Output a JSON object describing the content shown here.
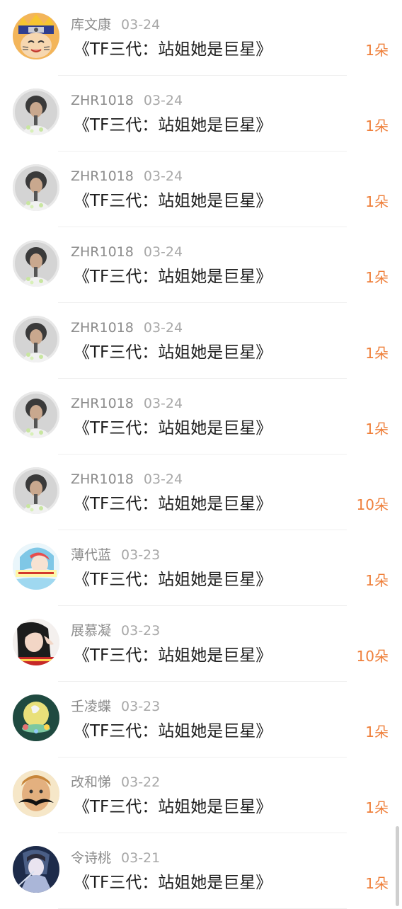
{
  "gift_list": [
    {
      "avatar": "avatar-naruto",
      "username": "库文康",
      "date": "03-24",
      "title": "《TF三代：站姐她是巨星》",
      "amount": "1朵"
    },
    {
      "avatar": "avatar-portrait-dark",
      "username": "ZHR1018",
      "date": "03-24",
      "title": "《TF三代：站姐她是巨星》",
      "amount": "1朵"
    },
    {
      "avatar": "avatar-portrait-dark",
      "username": "ZHR1018",
      "date": "03-24",
      "title": "《TF三代：站姐她是巨星》",
      "amount": "1朵"
    },
    {
      "avatar": "avatar-portrait-dark",
      "username": "ZHR1018",
      "date": "03-24",
      "title": "《TF三代：站姐她是巨星》",
      "amount": "1朵"
    },
    {
      "avatar": "avatar-portrait-dark",
      "username": "ZHR1018",
      "date": "03-24",
      "title": "《TF三代：站姐她是巨星》",
      "amount": "1朵"
    },
    {
      "avatar": "avatar-portrait-dark",
      "username": "ZHR1018",
      "date": "03-24",
      "title": "《TF三代：站姐她是巨星》",
      "amount": "1朵"
    },
    {
      "avatar": "avatar-portrait-dark",
      "username": "ZHR1018",
      "date": "03-24",
      "title": "《TF三代：站姐她是巨星》",
      "amount": "10朵"
    },
    {
      "avatar": "avatar-blue-anime",
      "username": "薄代蓝",
      "date": "03-23",
      "title": "《TF三代：站姐她是巨星》",
      "amount": "1朵"
    },
    {
      "avatar": "avatar-girl-dark-hair",
      "username": "展慕凝",
      "date": "03-23",
      "title": "《TF三代：站姐她是巨星》",
      "amount": "10朵"
    },
    {
      "avatar": "avatar-moon-green",
      "username": "壬凌蝶",
      "date": "03-23",
      "title": "《TF三代：站姐她是巨星》",
      "amount": "1朵"
    },
    {
      "avatar": "avatar-mustache-man",
      "username": "改和悌",
      "date": "03-22",
      "title": "《TF三代：站姐她是巨星》",
      "amount": "1朵"
    },
    {
      "avatar": "avatar-anime-warrior",
      "username": "令诗桃",
      "date": "03-21",
      "title": "《TF三代：站姐她是巨星》",
      "amount": "1朵"
    }
  ],
  "colors": {
    "username": "#8c8c8c",
    "date": "#a8a8a8",
    "title": "#1d1d1d",
    "amount": "#ef7f3a",
    "divider": "#efefef"
  }
}
